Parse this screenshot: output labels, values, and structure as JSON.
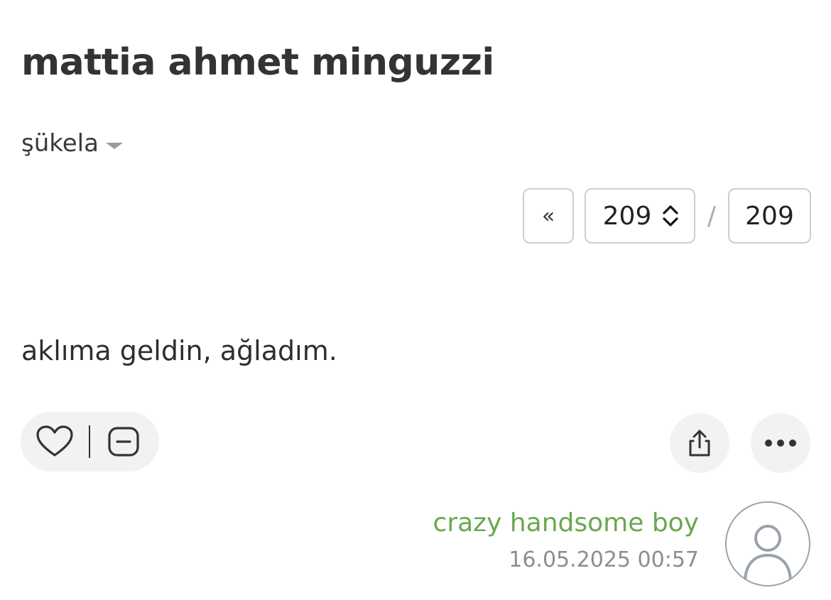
{
  "topic": {
    "title": "mattia ahmet minguzzi"
  },
  "sort": {
    "label": "şükela",
    "icon": "caret-down-icon"
  },
  "pagination": {
    "first_label": "«",
    "current_page": "209",
    "separator": "/",
    "total_pages": "209"
  },
  "entry": {
    "text": "aklıma geldin, ağladım.",
    "author": "crazy handsome boy",
    "date": "16.05.2025 00:57"
  },
  "actions": {
    "like_icon": "heart-icon",
    "dislike_icon": "minus-box-icon",
    "share_icon": "share-icon",
    "more_icon": "more-dots-icon"
  },
  "colors": {
    "author": "#6aa84f",
    "pill_background": "#f2f2f2",
    "border": "#c9cfd4"
  }
}
